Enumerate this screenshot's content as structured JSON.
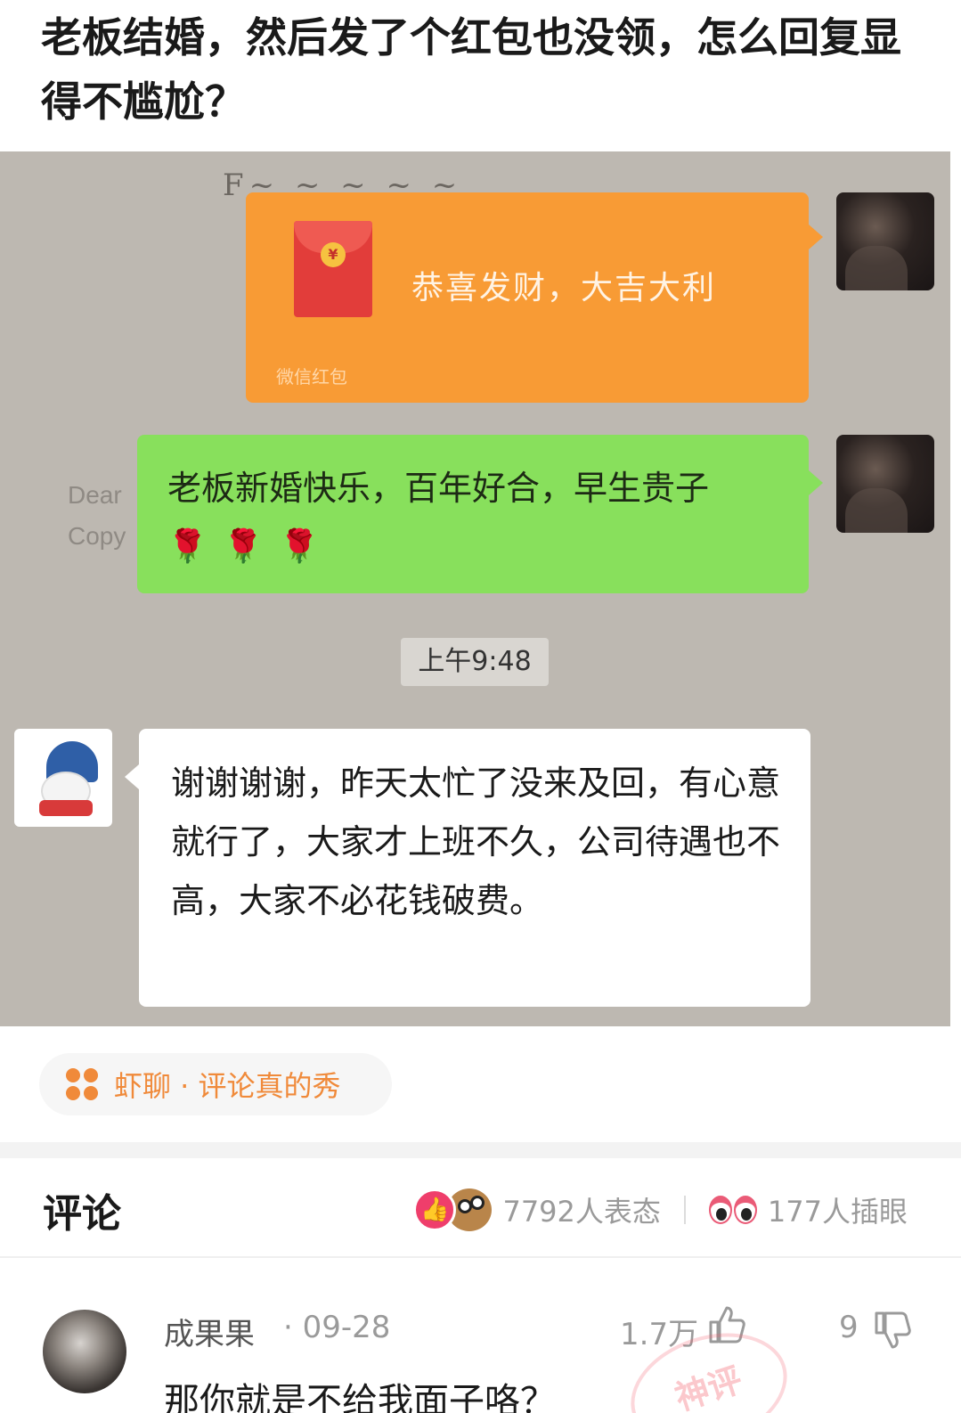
{
  "post": {
    "title": "老板结婚，然后发了个红包也没领，怎么回复显得不尴尬？"
  },
  "chat": {
    "red_packet": {
      "greeting": "恭喜发财，大吉大利",
      "footer": "微信红包"
    },
    "green_message": "老板新婚快乐，百年好合，早生贵子",
    "green_emoji": [
      "🌹",
      "🌹",
      "🌹"
    ],
    "ghost_text": [
      "Dear",
      "Copy"
    ],
    "time": "上午9:48",
    "reply_message": "谢谢谢谢，昨天太忙了没来及回，有心意就行了，大家才上班不久，公司待遇也不高，大家不必花钱破费。"
  },
  "topic": {
    "label": "虾聊 · 评论真的秀"
  },
  "comments": {
    "header": "评论",
    "reactions_count": "7792人表态",
    "insert_count": "177人插眼",
    "list": [
      {
        "author": "成果果",
        "date": "· 09-28",
        "likes": "1.7万",
        "dislikes": "9",
        "text": "那你就是不给我面子咯？",
        "stamp": "神评"
      }
    ]
  },
  "colors": {
    "accent_orange": "#f08a3a",
    "like_red": "#ef3e6b",
    "wechat_green": "#88e05c",
    "red_packet_orange": "#f89b35"
  }
}
